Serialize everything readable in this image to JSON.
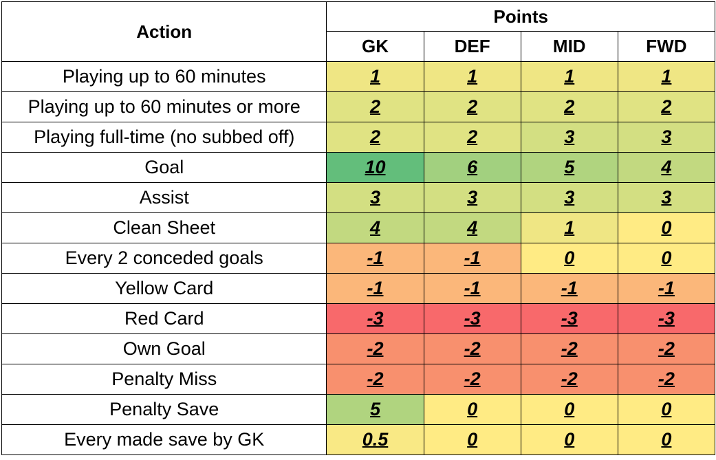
{
  "header": {
    "action_label": "Action",
    "points_label": "Points",
    "positions": [
      "GK",
      "DEF",
      "MID",
      "FWD"
    ]
  },
  "colors": {
    "10": "#63be7b",
    "6": "#a2d07f",
    "5": "#b0d47f",
    "4": "#c2d980",
    "3": "#d3df82",
    "2": "#e0e383",
    "1": "#efe684",
    "0.5": "#f9e985",
    "0": "#ffeb84",
    "-1": "#fbb77a",
    "-2": "#f8906e",
    "-3": "#f8696b"
  },
  "rows": [
    {
      "action": "Playing up to 60 minutes",
      "values": [
        "1",
        "1",
        "1",
        "1"
      ]
    },
    {
      "action": "Playing up to 60 minutes or more",
      "values": [
        "2",
        "2",
        "2",
        "2"
      ]
    },
    {
      "action": "Playing full-time (no subbed off)",
      "values": [
        "2",
        "2",
        "3",
        "3"
      ]
    },
    {
      "action": "Goal",
      "values": [
        "10",
        "6",
        "5",
        "4"
      ]
    },
    {
      "action": "Assist",
      "values": [
        "3",
        "3",
        "3",
        "3"
      ]
    },
    {
      "action": "Clean Sheet",
      "values": [
        "4",
        "4",
        "1",
        "0"
      ]
    },
    {
      "action": "Every 2 conceded goals",
      "values": [
        "-1",
        "-1",
        "0",
        "0"
      ]
    },
    {
      "action": "Yellow Card",
      "values": [
        "-1",
        "-1",
        "-1",
        "-1"
      ]
    },
    {
      "action": "Red Card",
      "values": [
        "-3",
        "-3",
        "-3",
        "-3"
      ]
    },
    {
      "action": "Own Goal",
      "values": [
        "-2",
        "-2",
        "-2",
        "-2"
      ]
    },
    {
      "action": "Penalty Miss",
      "values": [
        "-2",
        "-2",
        "-2",
        "-2"
      ]
    },
    {
      "action": "Penalty Save",
      "values": [
        "5",
        "0",
        "0",
        "0"
      ]
    },
    {
      "action": "Every made save by GK",
      "values": [
        "0.5",
        "0",
        "0",
        "0"
      ]
    }
  ]
}
